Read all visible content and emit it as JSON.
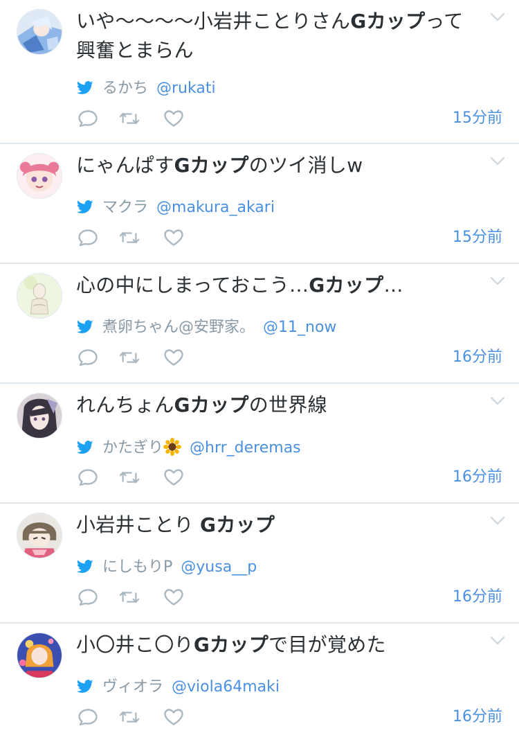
{
  "tweets": [
    {
      "text_parts": [
        "いや〜〜〜〜小岩井ことりさん",
        "Gカップ",
        "って興奮とまらん"
      ],
      "name": "るかち",
      "handle": "@rukati",
      "time": "15分前"
    },
    {
      "text_parts": [
        "にゃんぱす",
        "Gカップ",
        "のツイ消しw"
      ],
      "name": "マクラ",
      "handle": "@makura_akari",
      "time": "15分前"
    },
    {
      "text_parts": [
        "心の中にしまっておこう…",
        "Gカップ",
        "…"
      ],
      "name": "煮卵ちゃん@安野家。",
      "handle": "@11_now",
      "time": "16分前"
    },
    {
      "text_parts": [
        "れんちょん",
        "Gカップ",
        "の世界線"
      ],
      "name": "かたぎり",
      "name_emoji": "sunflower-icon",
      "handle": "@hrr_deremas",
      "time": "16分前"
    },
    {
      "text_parts": [
        "小岩井ことり ",
        "Gカップ",
        ""
      ],
      "name": "にしもりP",
      "handle": "@yusa__p",
      "time": "16分前"
    },
    {
      "text_parts": [
        "小〇井こ〇り",
        "Gカップ",
        "で目が覚めた"
      ],
      "name": "ヴィオラ",
      "handle": "@viola64maki",
      "time": "16分前"
    }
  ],
  "icons": {
    "source": "twitter-bird-icon",
    "reply": "reply-icon",
    "retweet": "retweet-icon",
    "like": "heart-icon",
    "menu": "chevron-down-icon"
  },
  "colors": {
    "text": "#292f33",
    "secondary": "#8899a6",
    "link": "#4a90e2",
    "bird": "#1da1f2",
    "divider": "#e1e8ed"
  }
}
